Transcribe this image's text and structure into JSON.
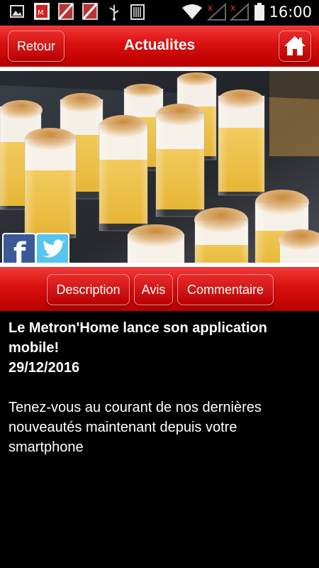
{
  "status_bar": {
    "time": "16:00",
    "icons": [
      "gallery-icon",
      "app-notification-icon",
      "app-notification-muted-icon",
      "app-notification-muted-icon",
      "usb-icon",
      "barcode-icon",
      "wifi-icon",
      "signal-icon",
      "signal-icon",
      "battery-icon"
    ]
  },
  "header": {
    "back_label": "Retour",
    "title": "Actualites",
    "home_icon": "home-icon"
  },
  "social": {
    "facebook_icon": "facebook-icon",
    "twitter_icon": "twitter-icon"
  },
  "tabs": [
    {
      "label": "Description"
    },
    {
      "label": "Avis"
    },
    {
      "label": "Commentaire"
    }
  ],
  "article": {
    "headline": "Le Metron'Home lance son application mobile!",
    "date": "29/12/2016",
    "body": "Tenez-vous au courant de nos dernières nouveautés maintenant depuis votre smartphone"
  },
  "colors": {
    "header_red": "#d90f0f",
    "background": "#000000",
    "text": "#ffffff"
  }
}
